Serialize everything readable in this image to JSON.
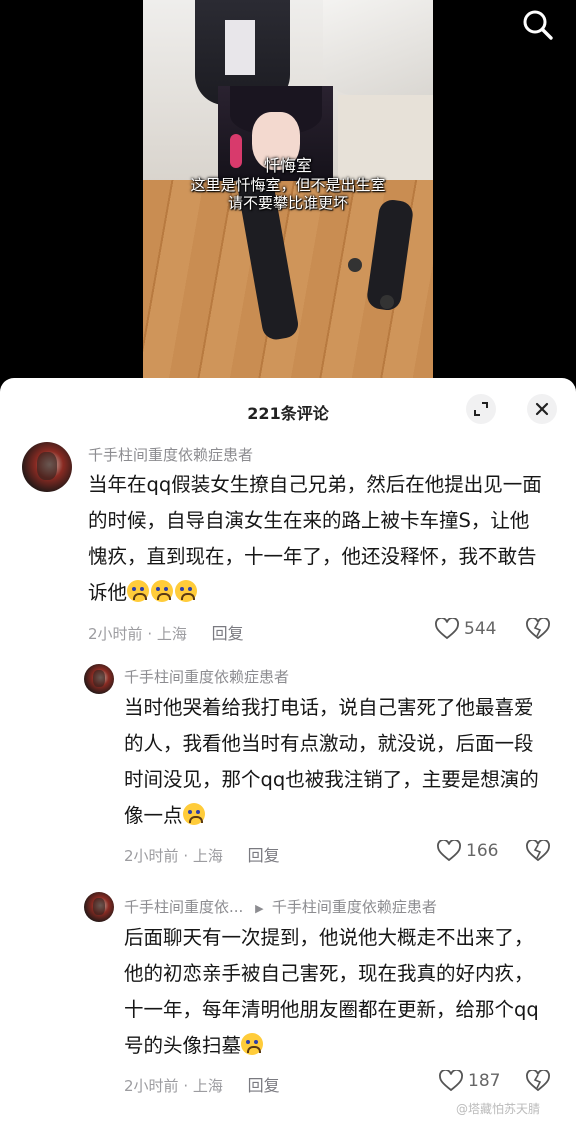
{
  "video": {
    "captions": [
      "忏悔室",
      "这里是忏悔室，但不是出生室",
      "请不要攀比谁更坏"
    ]
  },
  "panel": {
    "title": "221条评论"
  },
  "comments": [
    {
      "username": "千手柱间重度依赖症患者",
      "text": "当年在qq假装女生撩自己兄弟，然后在他提出见一面的时候，自导自演女生在来的路上被卡车撞S，让他愧疚，直到现在，十一年了，他还没释怀，我不敢告诉他",
      "emoji_count": 3,
      "time": "2小时前",
      "location": "上海",
      "reply_label": "回复",
      "likes": "544"
    },
    {
      "username": "千手柱间重度依赖症患者",
      "text": "当时他哭着给我打电话，说自己害死了他最喜爱的人，我看他当时有点激动，就没说，后面一段时间没见，那个qq也被我注销了，主要是想演的像一点",
      "emoji_count": 1,
      "time": "2小时前",
      "location": "上海",
      "reply_label": "回复",
      "likes": "166"
    },
    {
      "username": "千手柱间重度依...",
      "reply_to": "千手柱间重度依赖症患者",
      "text": "后面聊天有一次提到，他说他大概走不出来了，他的初恋亲手被自己害死，现在我真的好内疚，十一年，每年清明他朋友圈都在更新，给那个qq号的头像扫墓",
      "emoji_count": 1,
      "time": "2小时前",
      "location": "上海",
      "reply_label": "回复",
      "likes": "187"
    }
  ],
  "watermark": "@塔藏怕苏天腈",
  "icons": {
    "search": "search-icon",
    "expand": "expand-icon",
    "close": "close-icon",
    "like": "heart-icon",
    "dislike": "broken-heart-icon"
  }
}
